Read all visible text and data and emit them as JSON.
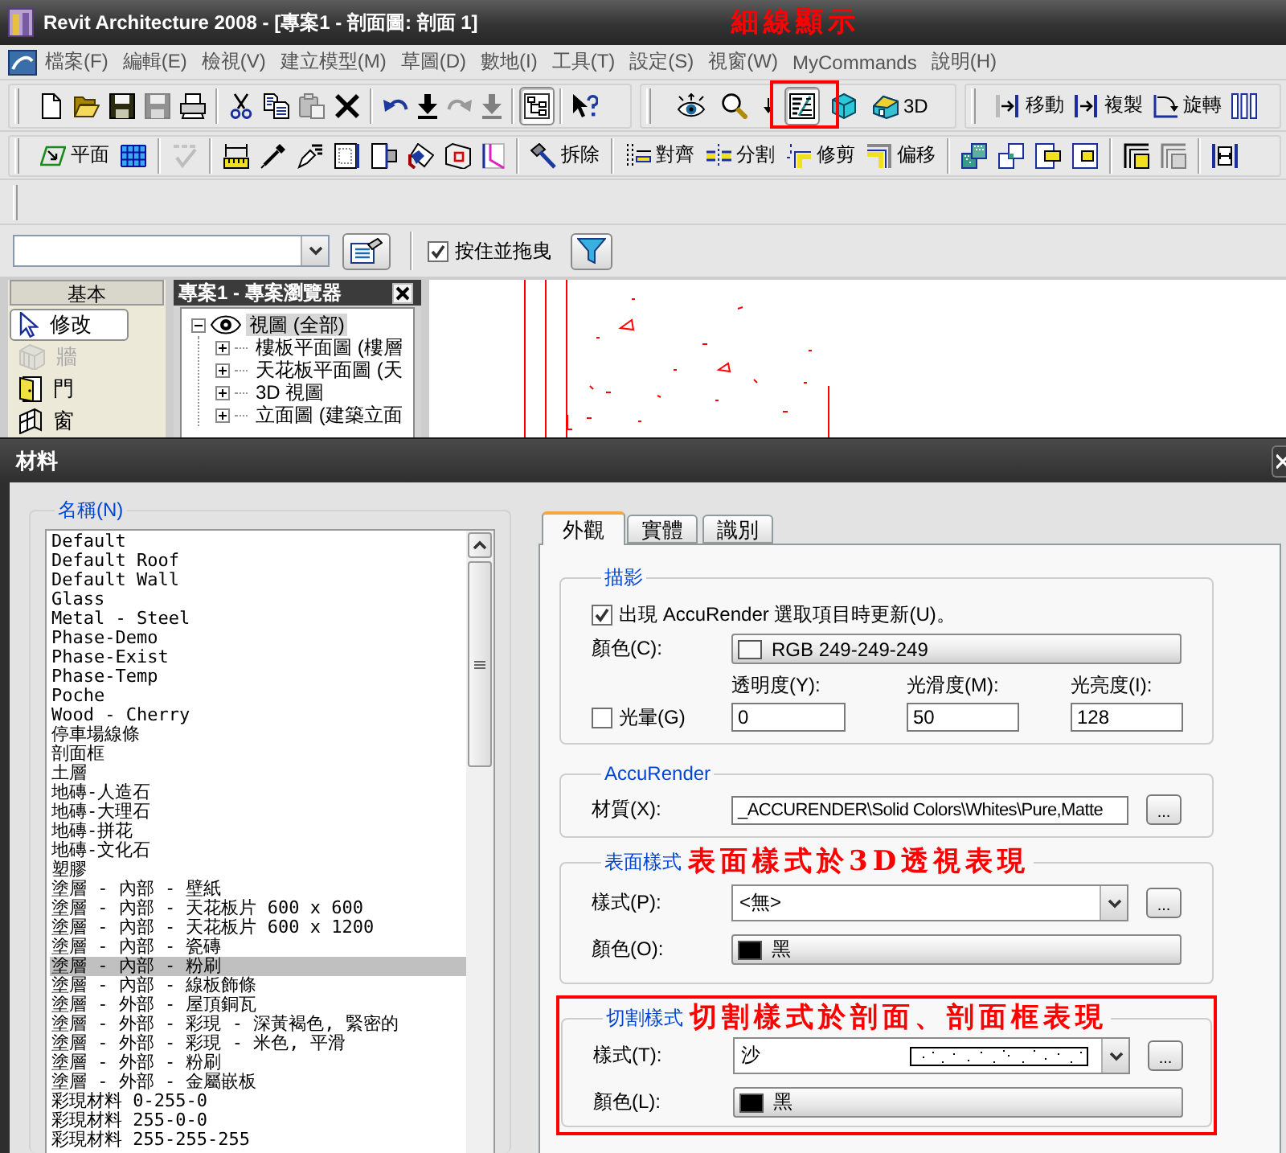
{
  "window": {
    "title": "Revit Architecture 2008 - [專案1 - 剖面圖: 剖面 1]",
    "annotation": "細線顯示"
  },
  "menu": [
    "檔案(F)",
    "編輯(E)",
    "檢視(V)",
    "建立模型(M)",
    "草圖(D)",
    "數地(I)",
    "工具(T)",
    "設定(S)",
    "視窗(W)",
    "MyCommands",
    "說明(H)"
  ],
  "toolbar_rows": [
    {
      "toolbars": [
        {
          "items": [
            {
              "kind": "button",
              "disabled": false,
              "pressed": false
            },
            {
              "kind": "button",
              "disabled": false,
              "pressed": false
            },
            {
              "kind": "button",
              "disabled": false,
              "pressed": false
            },
            {
              "kind": "button",
              "disabled": true,
              "pressed": false
            },
            {
              "kind": "button",
              "disabled": false,
              "pressed": false
            },
            {
              "kind": "separator"
            },
            {
              "kind": "button",
              "disabled": false,
              "pressed": false
            },
            {
              "kind": "button",
              "disabled": false,
              "pressed": false
            },
            {
              "kind": "button",
              "disabled": true,
              "pressed": false
            },
            {
              "kind": "button",
              "disabled": false,
              "pressed": false
            },
            {
              "kind": "separator"
            },
            {
              "kind": "button",
              "disabled": false,
              "pressed": false
            },
            {
              "kind": "button",
              "disabled": false,
              "pressed": false
            },
            {
              "kind": "button",
              "disabled": true,
              "pressed": false
            },
            {
              "kind": "button",
              "disabled": true,
              "pressed": false
            },
            {
              "kind": "separator"
            },
            {
              "kind": "button",
              "disabled": false,
              "pressed": true
            },
            {
              "kind": "separator"
            },
            {
              "kind": "button",
              "disabled": false,
              "pressed": false
            }
          ]
        },
        {
          "items": [
            {
              "kind": "button",
              "disabled": false,
              "pressed": false,
              "highlighted": false
            },
            {
              "kind": "button",
              "disabled": false,
              "pressed": false,
              "highlighted": false
            },
            {
              "kind": "button",
              "disabled": false,
              "pressed": false,
              "highlighted": false
            },
            {
              "kind": "button",
              "disabled": false,
              "pressed": true,
              "highlighted": true
            },
            {
              "kind": "button",
              "disabled": false,
              "pressed": false,
              "highlighted": false
            },
            {
              "kind": "button",
              "label": "3D",
              "disabled": false,
              "pressed": false,
              "highlighted": false
            }
          ]
        },
        {
          "items": [
            {
              "kind": "button",
              "label": "移動",
              "disabled": false,
              "pressed": false
            },
            {
              "kind": "button",
              "label": "複製",
              "disabled": false,
              "pressed": false
            },
            {
              "kind": "button",
              "label": "旋轉",
              "disabled": false,
              "pressed": false
            },
            {
              "kind": "button",
              "disabled": false,
              "pressed": false
            }
          ]
        }
      ]
    },
    {
      "toolbars": [
        {
          "items": [
            {
              "kind": "button",
              "label": "平面",
              "disabled": false,
              "pressed": false
            },
            {
              "kind": "button",
              "disabled": false,
              "pressed": false
            },
            {
              "kind": "separator"
            },
            {
              "kind": "button",
              "disabled": true,
              "pressed": false
            },
            {
              "kind": "separator"
            },
            {
              "kind": "button",
              "disabled": false,
              "pressed": false
            },
            {
              "kind": "button",
              "disabled": false,
              "pressed": false
            },
            {
              "kind": "button",
              "disabled": false,
              "pressed": false
            },
            {
              "kind": "button",
              "disabled": false,
              "pressed": false
            },
            {
              "kind": "button",
              "disabled": false,
              "pressed": false
            },
            {
              "kind": "button",
              "disabled": false,
              "pressed": false
            },
            {
              "kind": "button",
              "disabled": false,
              "pressed": false
            },
            {
              "kind": "button",
              "disabled": false,
              "pressed": false
            },
            {
              "kind": "separator"
            },
            {
              "kind": "button",
              "label": "拆除",
              "disabled": false,
              "pressed": false
            },
            {
              "kind": "separator"
            },
            {
              "kind": "button",
              "label": "對齊",
              "disabled": false,
              "pressed": false
            },
            {
              "kind": "button",
              "label": "分割",
              "disabled": false,
              "pressed": false
            },
            {
              "kind": "button",
              "label": "修剪",
              "disabled": false,
              "pressed": false
            },
            {
              "kind": "button",
              "label": "偏移",
              "disabled": false,
              "pressed": false
            },
            {
              "kind": "separator"
            },
            {
              "kind": "button",
              "disabled": false,
              "pressed": false
            },
            {
              "kind": "button",
              "disabled": false,
              "pressed": false
            },
            {
              "kind": "button",
              "disabled": false,
              "pressed": false
            },
            {
              "kind": "button",
              "disabled": false,
              "pressed": false
            },
            {
              "kind": "separator"
            },
            {
              "kind": "button",
              "disabled": false,
              "pressed": false
            },
            {
              "kind": "button",
              "disabled": true,
              "pressed": false
            },
            {
              "kind": "separator"
            },
            {
              "kind": "button",
              "disabled": false,
              "pressed": false
            }
          ]
        }
      ]
    }
  ],
  "options_bar": {
    "drag_checkbox": {
      "label": "按住並拖曳",
      "checked": true
    }
  },
  "design_bar": {
    "tab": "基本",
    "items": [
      {
        "label": "修改",
        "selected": true,
        "disabled": false
      },
      {
        "label": "牆",
        "selected": false,
        "disabled": true
      },
      {
        "label": "門",
        "selected": false,
        "disabled": false
      },
      {
        "label": "窗",
        "selected": false,
        "disabled": false
      }
    ]
  },
  "project_browser": {
    "title": "專案1 - 專案瀏覽器",
    "tree": [
      {
        "label": "視圖 (全部)",
        "expanded": true,
        "selected": true,
        "children": [
          {
            "label": "樓板平面圖 (樓層",
            "expanded": false,
            "selected": false
          },
          {
            "label": "天花板平面圖 (天",
            "expanded": false,
            "selected": false
          },
          {
            "label": "3D 視圖",
            "expanded": false,
            "selected": false
          },
          {
            "label": "立面圖 (建築立面",
            "expanded": false,
            "selected": false
          }
        ]
      }
    ]
  },
  "dialog": {
    "title": "材料",
    "materials": {
      "label": "名稱(N)",
      "items": [
        {
          "name": "Default",
          "selected": false
        },
        {
          "name": "Default Roof",
          "selected": false
        },
        {
          "name": "Default Wall",
          "selected": false
        },
        {
          "name": "Glass",
          "selected": false
        },
        {
          "name": "Metal - Steel",
          "selected": false
        },
        {
          "name": "Phase-Demo",
          "selected": false
        },
        {
          "name": "Phase-Exist",
          "selected": false
        },
        {
          "name": "Phase-Temp",
          "selected": false
        },
        {
          "name": "Poche",
          "selected": false
        },
        {
          "name": "Wood - Cherry",
          "selected": false
        },
        {
          "name": "停車場線條",
          "selected": false
        },
        {
          "name": "剖面框",
          "selected": false
        },
        {
          "name": "土層",
          "selected": false
        },
        {
          "name": "地磚-人造石",
          "selected": false
        },
        {
          "name": "地磚-大理石",
          "selected": false
        },
        {
          "name": "地磚-拼花",
          "selected": false
        },
        {
          "name": "地磚-文化石",
          "selected": false
        },
        {
          "name": "塑膠",
          "selected": false
        },
        {
          "name": "塗層 - 內部 - 壁紙",
          "selected": false
        },
        {
          "name": "塗層 - 內部 - 天花板片 600 x 600",
          "selected": false
        },
        {
          "name": "塗層 - 內部 - 天花板片 600 x 1200",
          "selected": false
        },
        {
          "name": "塗層 - 內部 - 瓷磚",
          "selected": false
        },
        {
          "name": "塗層 - 內部 - 粉刷",
          "selected": true
        },
        {
          "name": "塗層 - 內部 - 線板飾條",
          "selected": false
        },
        {
          "name": "塗層 - 外部 - 屋頂銅瓦",
          "selected": false
        },
        {
          "name": "塗層 - 外部 - 彩現 - 深黃褐色, 緊密的",
          "selected": false
        },
        {
          "name": "塗層 - 外部 - 彩現 - 米色, 平滑",
          "selected": false
        },
        {
          "name": "塗層 - 外部 - 粉刷",
          "selected": false
        },
        {
          "name": "塗層 - 外部 - 金屬嵌板",
          "selected": false
        },
        {
          "name": "彩現材料 0-255-0",
          "selected": false
        },
        {
          "name": "彩現材料 255-0-0",
          "selected": false
        },
        {
          "name": "彩現材料 255-255-255",
          "selected": false
        }
      ]
    },
    "tabs": [
      {
        "label": "外觀",
        "selected": true
      },
      {
        "label": "實體",
        "selected": false
      },
      {
        "label": "識別",
        "selected": false
      }
    ],
    "shading": {
      "title": "描影",
      "update": {
        "label": "出現 AccuRender 選取項目時更新(U)。",
        "checked": true
      },
      "color": {
        "label": "顏色(C):",
        "value": "RGB 249-249-249",
        "color": "#f9f9f9"
      },
      "glow": {
        "label": "光暈(G)",
        "checked": false
      },
      "fields": [
        {
          "label": "透明度(Y):",
          "value": "0"
        },
        {
          "label": "光滑度(M):",
          "value": "50"
        },
        {
          "label": "光亮度(I):",
          "value": "128"
        }
      ]
    },
    "accurender": {
      "title": "AccuRender",
      "label": "材質(X):",
      "value": "_ACCURENDER\\Solid Colors\\Whites\\Pure,Matte",
      "button": "..."
    },
    "pattern_groups": [
      {
        "title": "表面樣式",
        "annotation": "表面樣式於3D透視表現",
        "highlighted": false,
        "pattern": {
          "label": "樣式(P):",
          "value": "<無>",
          "preview": false
        },
        "button": "...",
        "color": {
          "label": "顏色(O):",
          "value": "黑",
          "color": "#000000"
        }
      },
      {
        "title": "切割樣式",
        "annotation": "切割樣式於剖面、剖面框表現",
        "highlighted": true,
        "pattern": {
          "label": "樣式(T):",
          "value": "沙",
          "preview": true
        },
        "button": "...",
        "color": {
          "label": "顏色(L):",
          "value": "黑",
          "color": "#000000"
        }
      }
    ]
  }
}
